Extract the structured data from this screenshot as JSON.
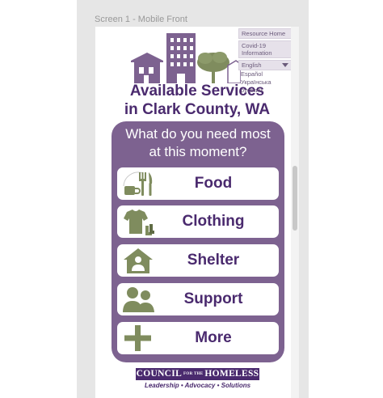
{
  "editor": {
    "frame_label": "Screen 1 - Mobile Front"
  },
  "header": {
    "title_line1": "Available Services",
    "title_line2": "in Clark County, WA"
  },
  "side_menu": {
    "resource_home": "Resource Home",
    "covid_info": "Covid-19 Information",
    "language_selected": "English",
    "language_options": [
      "Español",
      "Українська",
      "русский"
    ]
  },
  "panel": {
    "question_line1": "What do you need most",
    "question_line2": "at this moment?"
  },
  "services": [
    {
      "label": "Food",
      "icon": "fork-knife-cup-icon"
    },
    {
      "label": "Clothing",
      "icon": "tshirt-socks-icon"
    },
    {
      "label": "Shelter",
      "icon": "house-person-icon"
    },
    {
      "label": "Support",
      "icon": "people-icon"
    },
    {
      "label": "More",
      "icon": "plus-icon"
    }
  ],
  "footer": {
    "org_prefix": "COUNCIL",
    "org_small": "FOR THE",
    "org_suffix": "HOMELESS",
    "tagline": "Leadership • Advocacy • Solutions"
  },
  "colors": {
    "purple_dark": "#4a2a6e",
    "purple_panel": "#7d6290",
    "olive_icon": "#7f8c5e",
    "canvas_gray": "#e6e6e6"
  }
}
